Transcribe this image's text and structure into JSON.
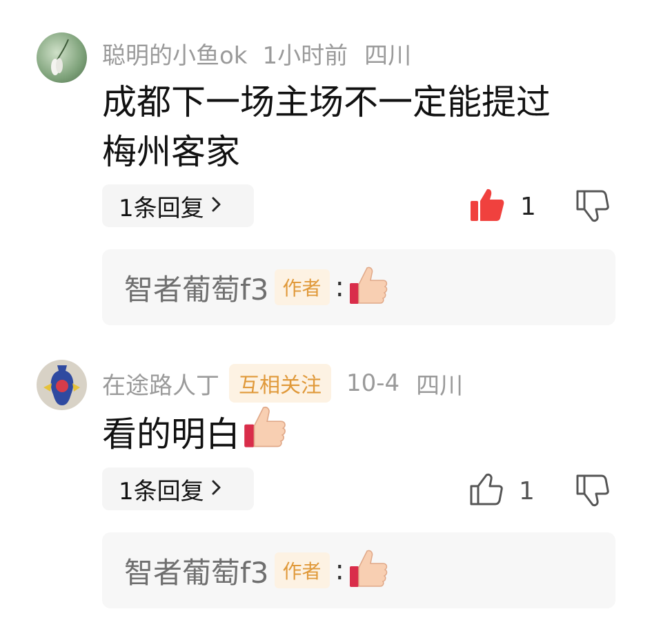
{
  "comments": [
    {
      "username": "聪明的小鱼ok",
      "time": "1小时前",
      "location": "四川",
      "text_line1": "成都下一场主场不一定能提过",
      "text_line2": "梅州客家",
      "reply_label": "1条回复",
      "like_count": "1",
      "liked": true,
      "reply_preview": {
        "name": "智者葡萄f3",
        "author_tag": "作者",
        "colon": ":"
      }
    },
    {
      "username": "在途路人丁",
      "follow_tag": "互相关注",
      "time": "10-4",
      "location": "四川",
      "text": "看的明白",
      "reply_label": "1条回复",
      "like_count": "1",
      "liked": false,
      "reply_preview": {
        "name": "智者葡萄f3",
        "author_tag": "作者",
        "colon": ":"
      }
    }
  ],
  "icons": {
    "like_filled": "thumbs-up-filled-icon",
    "like_outline": "thumbs-up-outline-icon",
    "dislike": "thumbs-down-outline-icon",
    "emoji": "thumbs-up-emoji"
  },
  "colors": {
    "like_active": "#f0413e",
    "tag_bg": "#fdf2e3",
    "tag_text": "#e0993a",
    "meta_gray": "#9a9a9a"
  }
}
